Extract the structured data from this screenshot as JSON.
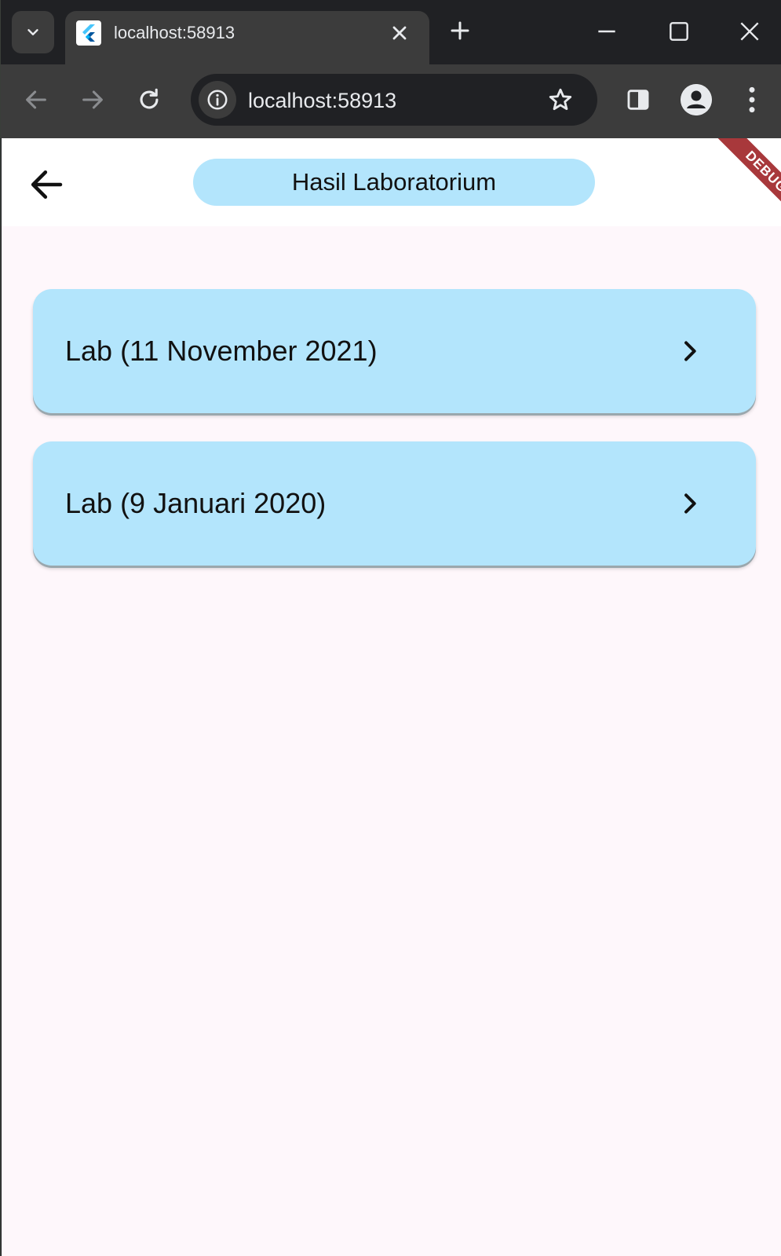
{
  "browser": {
    "tab_title": "localhost:58913",
    "url": "localhost:58913"
  },
  "app": {
    "title": "Hasil Laboratorium",
    "debug_label": "DEBUG",
    "accent_color": "#b3e5fc",
    "background_color": "#fef7fb"
  },
  "labs": [
    {
      "label": "Lab (11 November 2021)"
    },
    {
      "label": "Lab (9 Januari 2020)"
    }
  ],
  "icons": {
    "tab_search": "chevron-down-icon",
    "favicon": "flutter-logo",
    "close": "close-icon",
    "new_tab": "plus-icon",
    "back": "arrow-left-icon",
    "forward": "arrow-right-icon",
    "reload": "reload-icon",
    "site_info": "info-icon",
    "bookmark": "star-icon",
    "side_panel": "side-panel-icon",
    "profile": "account-icon",
    "menu": "more-vert-icon",
    "chevron": "chevron-right-icon"
  }
}
